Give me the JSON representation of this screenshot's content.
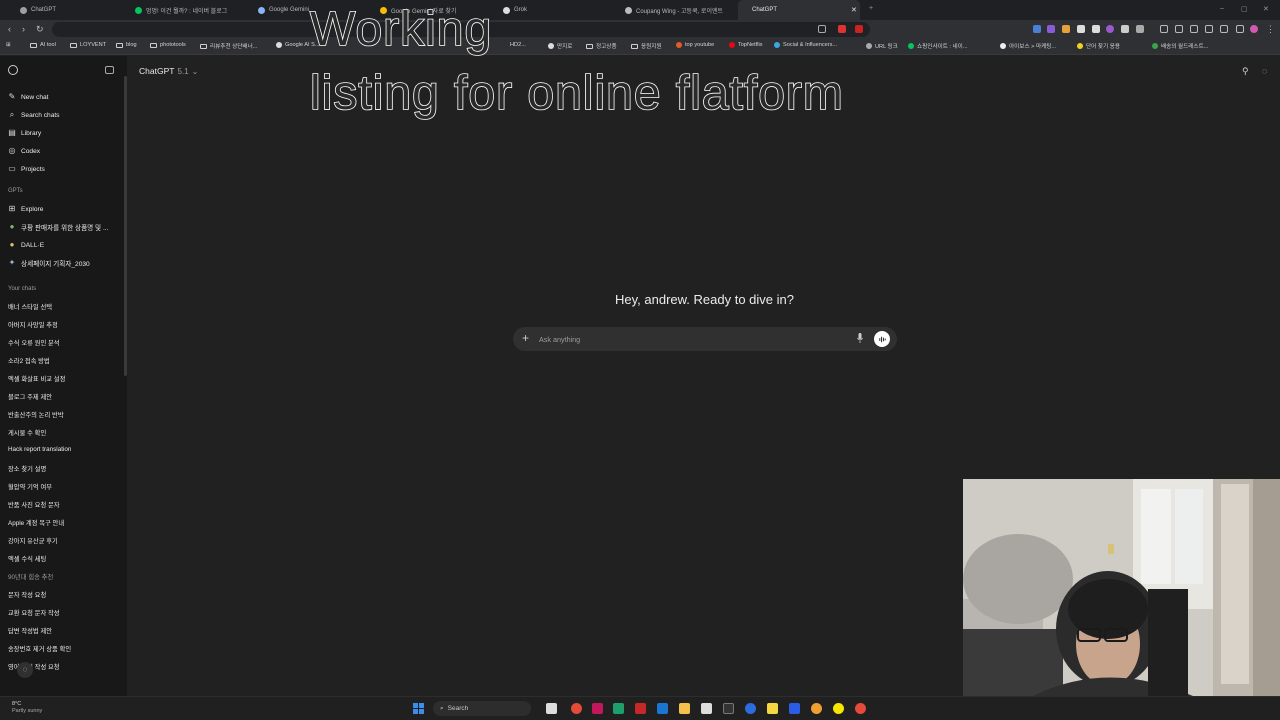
{
  "browser": {
    "tabs": [
      {
        "title": "ChatGPT",
        "color": "#9aa0a6"
      },
      {
        "title": "멍멍! 이건 뭘까? : 네이버 블로그",
        "color": "#03c75a"
      },
      {
        "title": "Google Gemini",
        "color": "#8ab4f8"
      },
      {
        "title": "Google Gemini 자료 찾기",
        "color": "#fbbc04"
      },
      {
        "title": "Grok",
        "color": "#dddddd"
      },
      {
        "title": "Coupang Wing - 고등쿡, 로이엔트",
        "color": "#bbbbbb"
      },
      {
        "title": "ChatGPT",
        "color": "#cccccc",
        "active": true
      }
    ],
    "bookmarks": [
      "AI tool",
      "LOYVENT",
      "blog",
      "phototools",
      "리뷰추천 상단배너...",
      "Google AI S...",
      "HD2...",
      "만지로",
      "정고상품",
      "응원지원",
      "top youtube",
      "TopNetflix",
      "Social & Influencers...",
      "URL 링크",
      "쇼핑인사이트 : 네이...",
      "아이보스 > 마케팅...",
      "단어 찾기 응용",
      "배송의 월드레스트..."
    ]
  },
  "caption": {
    "line1": "Working",
    "line2": "listing for online flatform"
  },
  "sidebar": {
    "nav": [
      {
        "label": "New chat",
        "icon": "✎"
      },
      {
        "label": "Search chats",
        "icon": "⌕"
      },
      {
        "label": "Library",
        "icon": "▤"
      },
      {
        "label": "Codex",
        "icon": "◎"
      },
      {
        "label": "Projects",
        "icon": "▭"
      }
    ],
    "gpts_label": "GPTs",
    "gpts": [
      {
        "label": "Explore",
        "icon": "⊞"
      },
      {
        "label": "쿠팡 판매자를 위한 상품명 및 ...",
        "icon": "●"
      },
      {
        "label": "DALL·E",
        "icon": "●"
      },
      {
        "label": "상세페이지 기획자_2030",
        "icon": "✦"
      }
    ],
    "chats_label": "Your chats",
    "chats": [
      "배너 스타일 선택",
      "아버지 사망일 추정",
      "수식 오류 원인 분석",
      "소라2 접속 방법",
      "엑셀 화살표 비교 설정",
      "블로그 주제 제안",
      "반출산주의 논리 반박",
      "게시물 수 확인",
      "Hack report translation",
      "장소 찾기 설명",
      "혈압약 기억 여부",
      "반품 사진 요청 문자",
      "Apple 계정 복구 안내",
      "강아지 유산균 후기",
      "엑셀 수식 세팅",
      "90년대 힙송 추천",
      "문자 작성 요청",
      "교환 요청 문자 작성",
      "답변 작성법 제안",
      "송장번호 제거 상품 확인",
      "영어 편지 작성 요청"
    ]
  },
  "main": {
    "model_name": "ChatGPT",
    "model_version": "5.1",
    "greeting": "Hey, andrew. Ready to dive in?",
    "composer_placeholder": "Ask anything"
  },
  "taskbar": {
    "weather_temp": "8°C",
    "weather_desc": "Partly sunny",
    "search_label": "Search"
  }
}
